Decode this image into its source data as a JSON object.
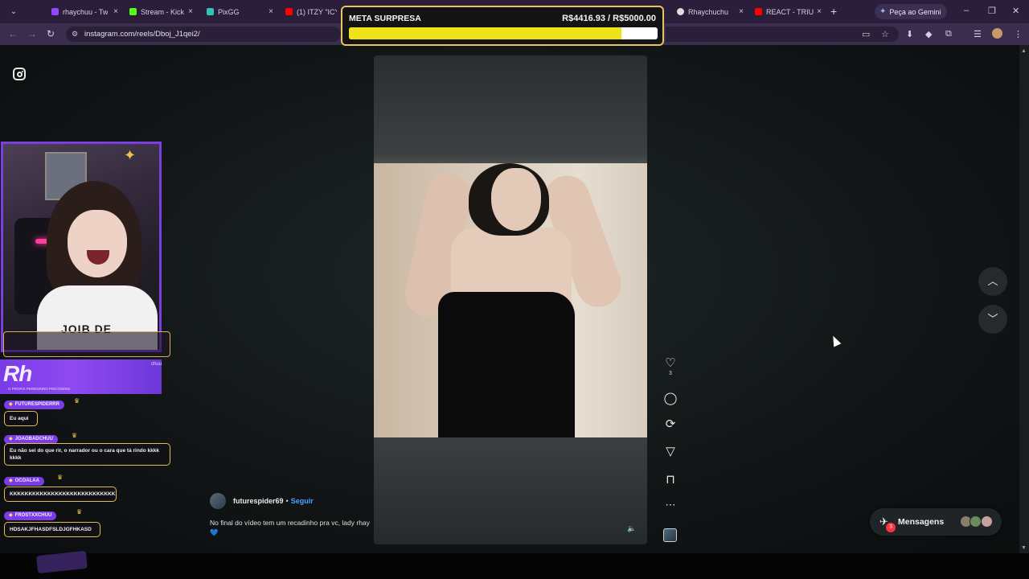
{
  "browser": {
    "tabs": [
      {
        "label": "rhaychuu - Tw",
        "favicon_color": "#9146ff"
      },
      {
        "label": "Stream - Kick",
        "favicon_color": "#53fc18"
      },
      {
        "label": "PixGG",
        "favicon_color": "#2ec4b6"
      },
      {
        "label": "(1) ITZY \"ICY\"",
        "favicon_color": "#ff0000"
      },
      {
        "label": "Rhaychuchu",
        "favicon_color": "#dddddd"
      },
      {
        "label": "REACT - TRIU",
        "favicon_color": "#ff0000"
      }
    ],
    "gemini_label": "Peça ao Gemini",
    "url": "instagram.com/reels/Dboj_J1qei2/"
  },
  "goal": {
    "title": "META SURPRESA",
    "value_text": "R$4416.93 / R$5000.00",
    "progress_fraction": 0.883,
    "bar_color": "#f0e21a",
    "frame_color": "#e7c55a"
  },
  "reel": {
    "author": "futurespider69",
    "separator": "•",
    "follow_label": "Seguir",
    "caption": "No final do vídeo tem um recadinho pra vc, lady rhay 💙",
    "like_count": "3",
    "icons": [
      "heart-icon",
      "comment-icon",
      "repost-icon",
      "share-icon",
      "bookmark-icon",
      "more-icon"
    ]
  },
  "messages": {
    "label": "Mensagens",
    "badge": "3"
  },
  "stream_overlay": {
    "banner_text": "Rh",
    "banner_subtext": "O PROFIS PEREGRINO PSICOSENS",
    "banner_badge": "chuu",
    "webcam_shirt_text": "JOIB DE",
    "chat": [
      {
        "user": "FUTURESPIDERRR",
        "message": "Eu aqui"
      },
      {
        "user": "JOAOBADCHUU",
        "message": "Eu não sei do que rir, o narrador ou o cara que tá rindo kkkk kkkk"
      },
      {
        "user": "OCOALAA",
        "message": "KKKKKKKKKKKKKKKKKKKKKKKKKKKK"
      },
      {
        "user": "FROSTXXCHUU",
        "message": "HDSAKJFHASDFSLDJGFHKASD"
      }
    ]
  },
  "colors": {
    "accent_purple": "#7b3fe0",
    "chat_border": "#e2bd54",
    "link_blue": "#4aa3ff",
    "notification_red": "#ff3040"
  }
}
